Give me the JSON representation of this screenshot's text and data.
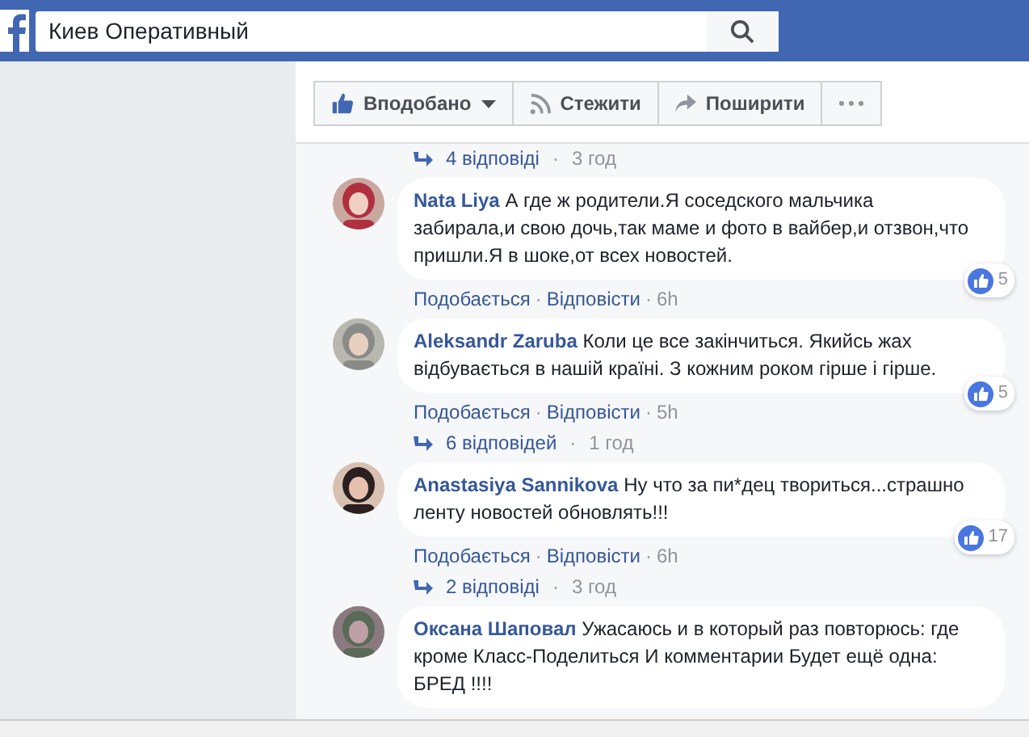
{
  "search": {
    "value": "Киев Оперативный"
  },
  "actions": [
    {
      "kind": "like",
      "label": "Вподобано"
    },
    {
      "kind": "follow",
      "label": "Стежити"
    },
    {
      "kind": "share",
      "label": "Поширити"
    },
    {
      "kind": "more"
    }
  ],
  "feed": [
    {
      "kind": "replies",
      "count": "4 відповіді",
      "sep": "·",
      "time": "3 год"
    },
    {
      "kind": "comment",
      "author": "Nata Liya",
      "text": "А где ж родители.Я соседского мальчика забирала,и свою дочь,так маме и фото в вайбер,и отзвон,что пришли.Я в шоке,от всех новостей.",
      "like": "Подобається",
      "sep1": "·",
      "reply": "Відповісти",
      "sep2": "·",
      "time": "6h",
      "reactions": "5"
    },
    {
      "kind": "comment",
      "author": "Aleksandr Zaruba",
      "text": "Коли це все закінчиться. Якийсь жах відбувається в нашій країні. З кожним роком гірше і гірше.",
      "like": "Подобається",
      "sep1": "·",
      "reply": "Відповісти",
      "sep2": "·",
      "time": "5h",
      "reactions": "5"
    },
    {
      "kind": "replies",
      "count": "6 відповідей",
      "sep": "·",
      "time": "1 год"
    },
    {
      "kind": "comment",
      "author": "Anastasiya Sannikova",
      "text": "Ну что за пи*дец твориться...страшно ленту новостей обновлять!!!",
      "like": "Подобається",
      "sep1": "·",
      "reply": "Відповісти",
      "sep2": "·",
      "time": "6h",
      "reactions": "17"
    },
    {
      "kind": "replies",
      "count": "2 відповіді",
      "sep": "·",
      "time": "3 год"
    },
    {
      "kind": "comment",
      "author": "Оксана Шаповал",
      "text": "Ужасаюсь и в который раз повторюсь: где кроме Класс-Поделиться И комментарии Будет ещё одна: БРЕД !!!!"
    }
  ]
}
